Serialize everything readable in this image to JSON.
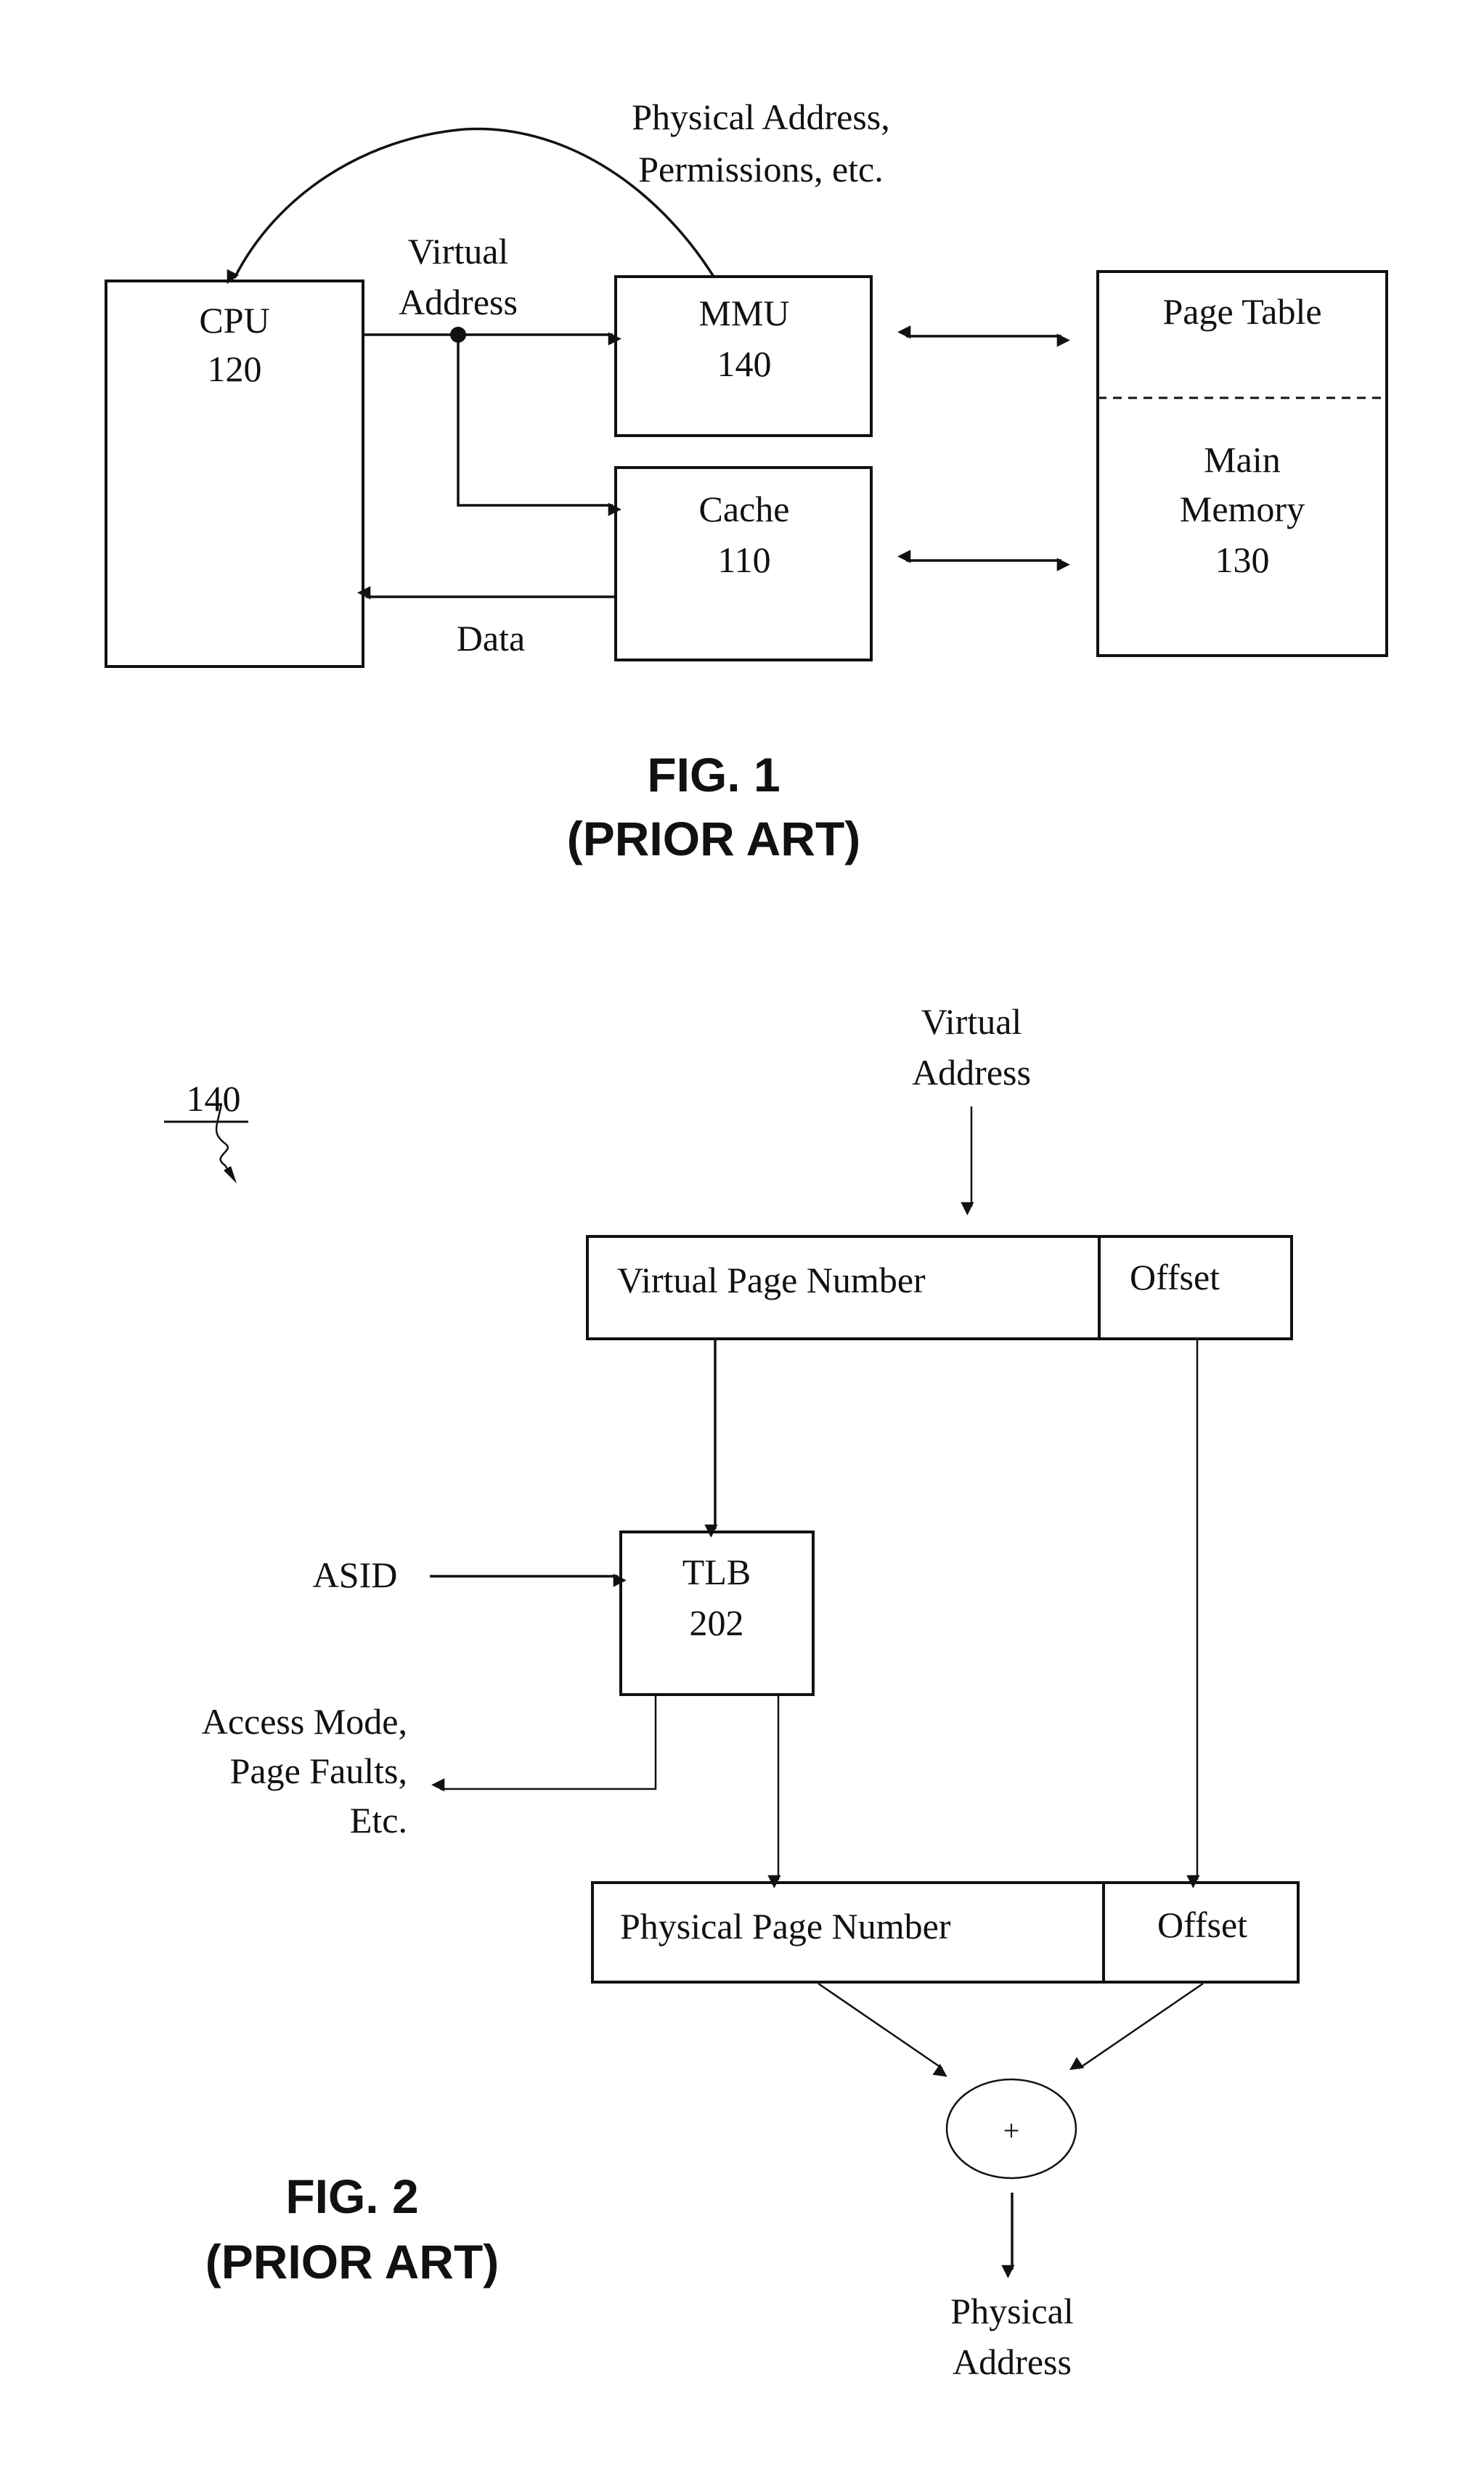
{
  "figure1": {
    "caption": "FIG. 1",
    "subcaption": "(PRIOR ART)",
    "cpu": {
      "name": "CPU",
      "ref": "120"
    },
    "mmu": {
      "name": "MMU",
      "ref": "140"
    },
    "cache": {
      "name": "Cache",
      "ref": "110"
    },
    "memory": {
      "top_label": "Page Table",
      "name_line1": "Main",
      "name_line2": "Memory",
      "ref": "130"
    },
    "feedback_label_line1": "Physical Address,",
    "feedback_label_line2": "Permissions, etc.",
    "va_label_line1": "Virtual",
    "va_label_line2": "Address",
    "data_label": "Data"
  },
  "figure2": {
    "caption": "FIG. 2",
    "subcaption": "(PRIOR ART)",
    "ref_label": "140",
    "input_label_line1": "Virtual",
    "input_label_line2": "Address",
    "virtual_page_number": "Virtual Page Number",
    "virtual_offset": "Offset",
    "asid_label": "ASID",
    "tlb": {
      "name": "TLB",
      "ref": "202"
    },
    "side_output_line1": "Access Mode,",
    "side_output_line2": "Page Faults,",
    "side_output_line3": "Etc.",
    "physical_page_number": "Physical Page Number",
    "physical_offset": "Offset",
    "adder_symbol": "+",
    "output_label_line1": "Physical",
    "output_label_line2": "Address"
  }
}
